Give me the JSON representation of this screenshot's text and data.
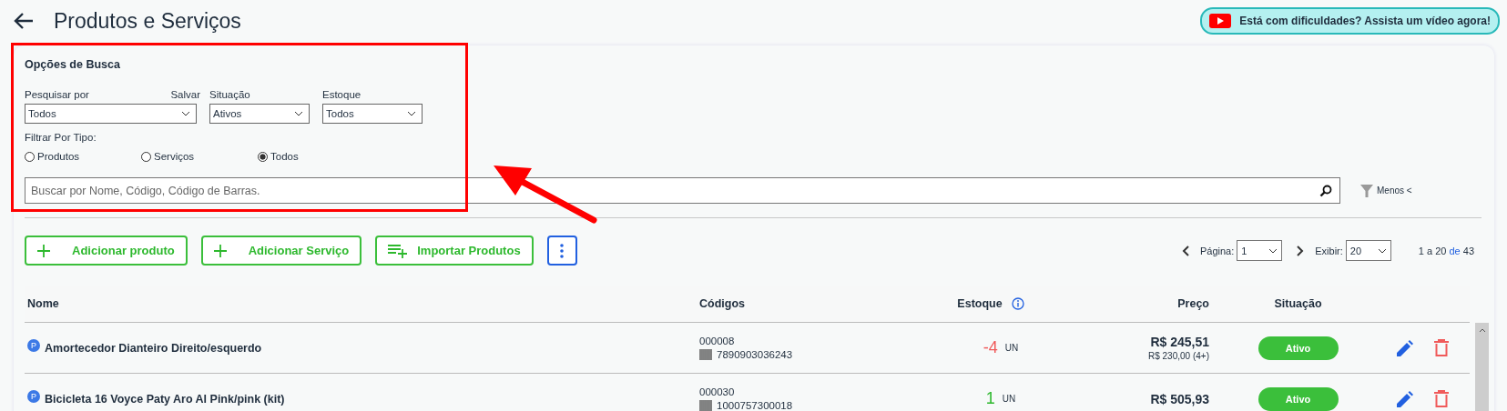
{
  "header": {
    "title": "Produtos e Serviços",
    "help_button": "Está com dificuldades? Assista um vídeo agora!"
  },
  "search_options": {
    "title": "Opções de Busca",
    "filters": [
      {
        "label": "Pesquisar por",
        "value": "Todos",
        "action": "Salvar"
      },
      {
        "label": "Situação",
        "value": "Ativos"
      },
      {
        "label": "Estoque",
        "value": "Todos"
      }
    ],
    "type_filter": {
      "label": "Filtrar Por Tipo:",
      "options": [
        {
          "label": "Produtos",
          "selected": false
        },
        {
          "label": "Serviços",
          "selected": false
        },
        {
          "label": "Todos",
          "selected": true
        }
      ]
    },
    "search": {
      "placeholder": "Buscar por Nome, Código, Código de Barras."
    },
    "toggle": "Menos <"
  },
  "actions": [
    {
      "label": "Adicionar produto",
      "kind": "add"
    },
    {
      "label": "Adicionar Serviço",
      "kind": "add"
    },
    {
      "label": "Importar Produtos",
      "kind": "import"
    }
  ],
  "pagination": {
    "page_label": "Página:",
    "page": "1",
    "show_label": "Exibir:",
    "show": "20",
    "range": "1 a 20",
    "of": "de",
    "total": "43"
  },
  "table": {
    "columns": [
      "Nome",
      "Códigos",
      "Estoque",
      "Preço",
      "Situação"
    ],
    "rows": [
      {
        "type": "P",
        "name": "Amortecedor Dianteiro Direito/esquerdo",
        "code": "000008",
        "barcode": "7890903036243",
        "stock": "-4",
        "color": "#f05a5a",
        "unit": "UN",
        "price": "R$ 245,51",
        "price_note": "R$ 230,00 (4+)",
        "status": "Ativo"
      },
      {
        "type": "P",
        "name": "Bicicleta 16 Voyce Paty Aro Al Pink/pink (kit)",
        "code": "000030",
        "barcode": "1000757300018",
        "stock": "1",
        "color": "#2db82d",
        "unit": "UN",
        "price": "R$ 505,93",
        "status": "Ativo"
      }
    ]
  }
}
